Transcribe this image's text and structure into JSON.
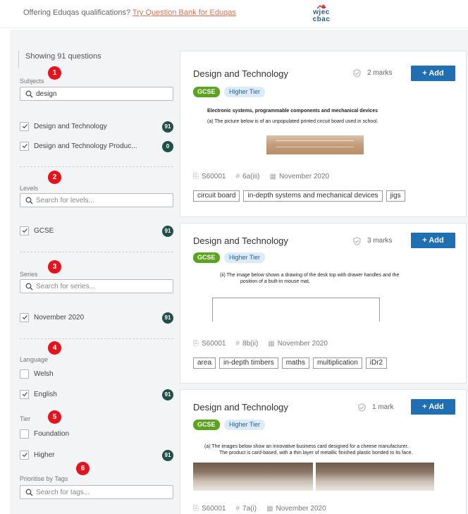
{
  "banner": {
    "offer_text": "Offering Eduqas qualifications?",
    "offer_link": "Try Question Bank for Eduqas",
    "logo_line1": "wjec",
    "logo_line2": "cbac"
  },
  "sidebar": {
    "showing": "Showing 91 questions",
    "markers": [
      "1",
      "2",
      "3",
      "4",
      "5",
      "6"
    ],
    "subjects": {
      "label": "Subjects",
      "search_value": "design",
      "options": [
        {
          "label": "Design and Technology",
          "checked": true,
          "count": "91"
        },
        {
          "label": "Design and Technology Produc...",
          "checked": true,
          "count": "0"
        }
      ]
    },
    "levels": {
      "label": "Levels",
      "placeholder": "Search for levels...",
      "options": [
        {
          "label": "GCSE",
          "checked": true,
          "count": "91"
        }
      ]
    },
    "series": {
      "label": "Series",
      "placeholder": "Search for series...",
      "options": [
        {
          "label": "November 2020",
          "checked": true,
          "count": "91"
        }
      ]
    },
    "language": {
      "label": "Language",
      "options": [
        {
          "label": "Welsh",
          "checked": false
        },
        {
          "label": "English",
          "checked": true,
          "count": "91"
        }
      ]
    },
    "tier": {
      "label": "Tier",
      "options": [
        {
          "label": "Foundation",
          "checked": false
        },
        {
          "label": "Higher",
          "checked": true,
          "count": "91"
        }
      ]
    },
    "tags": {
      "label": "Prioritise by Tags",
      "placeholder": "Search for tags..."
    }
  },
  "questions": [
    {
      "title": "Design and Technology",
      "marks": "2 marks",
      "add_label": "+ Add",
      "level": "GCSE",
      "tier": "Higher Tier",
      "heading": "Electronic systems, programmable components and mechanical devices",
      "text": "(a)    The picture below is of an unpopulated printed circuit board used in school.",
      "code": "S60001",
      "number": "6a(iii)",
      "series": "November 2020",
      "tags": [
        "circuit board",
        "in-depth systems and mechanical devices",
        "jigs"
      ]
    },
    {
      "title": "Design and Technology",
      "marks": "3 marks",
      "add_label": "+ Add",
      "level": "GCSE",
      "tier": "Higher Tier",
      "text_line1": "(ii)    The image below shows a drawing of the desk top with drawer handles and the",
      "text_line2": "position of a built-in mouse mat.",
      "code": "S60001",
      "number": "8b(ii)",
      "series": "November 2020",
      "tags": [
        "area",
        "in-depth timbers",
        "maths",
        "multiplication",
        "iDr2"
      ]
    },
    {
      "title": "Design and Technology",
      "marks": "1 mark",
      "add_label": "+ Add",
      "level": "GCSE",
      "tier": "Higher Tier",
      "text_line1": "(a)    The images below show an innovative business card designed for a cheese manufacturer.",
      "text_line2": "The product is card-based, with a thin layer of metallic finished plastic bonded to its face.",
      "code": "S60001",
      "number": "7a(i)",
      "series": "November 2020"
    }
  ],
  "colors": {
    "accent_button": "#1f6fb2",
    "gcse_badge": "#5aa51d",
    "tier_badge": "#dcebf7",
    "count_badge": "#214f4a",
    "marker": "#e3141c",
    "link": "#e56c4b"
  },
  "icons": [
    "search-icon",
    "checkbox-tick-icon",
    "shield-check-icon",
    "copy-icon",
    "hash-icon",
    "calendar-icon",
    "wjec-logo-icon"
  ]
}
